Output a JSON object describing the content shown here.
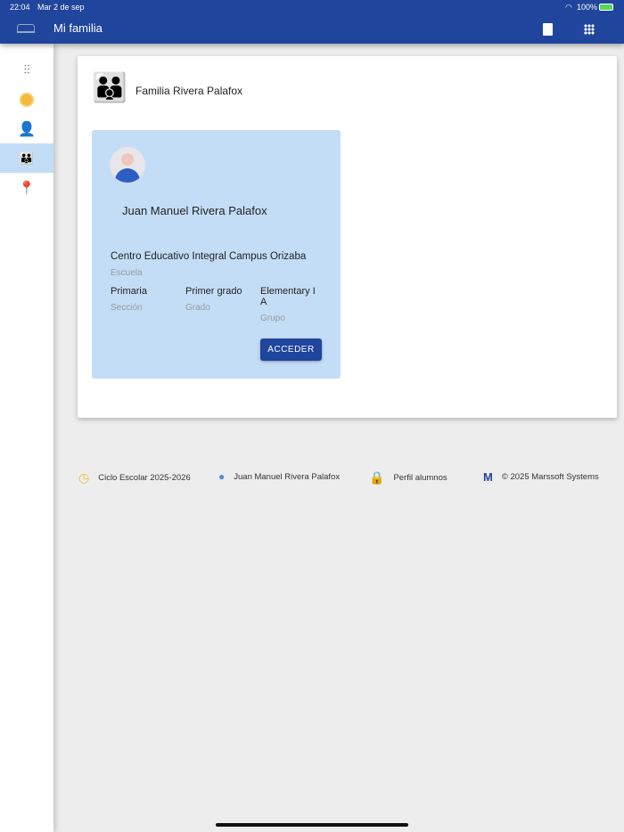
{
  "status": {
    "time": "22:04",
    "date": "Mar 2 de sep",
    "battery": "100%"
  },
  "header": {
    "title": "Mi familia"
  },
  "sidebar": {
    "items": [
      {
        "name": "settings"
      },
      {
        "name": "payments"
      },
      {
        "name": "profile"
      },
      {
        "name": "family",
        "active": true
      },
      {
        "name": "location"
      }
    ]
  },
  "family": {
    "title": "Familia Rivera Palafox"
  },
  "student": {
    "name": "Juan Manuel Rivera Palafox",
    "school": "Centro Educativo Integral Campus Orizaba",
    "school_label": "Escuela",
    "section": "Primaria",
    "section_label": "Sección",
    "grade": "Primer grado",
    "grade_label": "Grado",
    "group": "Elementary I A",
    "group_label": "Grupo",
    "access_label": "ACCEDER"
  },
  "footer": {
    "cycle": "Ciclo Escolar 2025-2026",
    "user": "Juan Manuel Rivera Palafox",
    "profile": "Perfil alumnos",
    "copyright": "© 2025 Marssoft Systems"
  }
}
